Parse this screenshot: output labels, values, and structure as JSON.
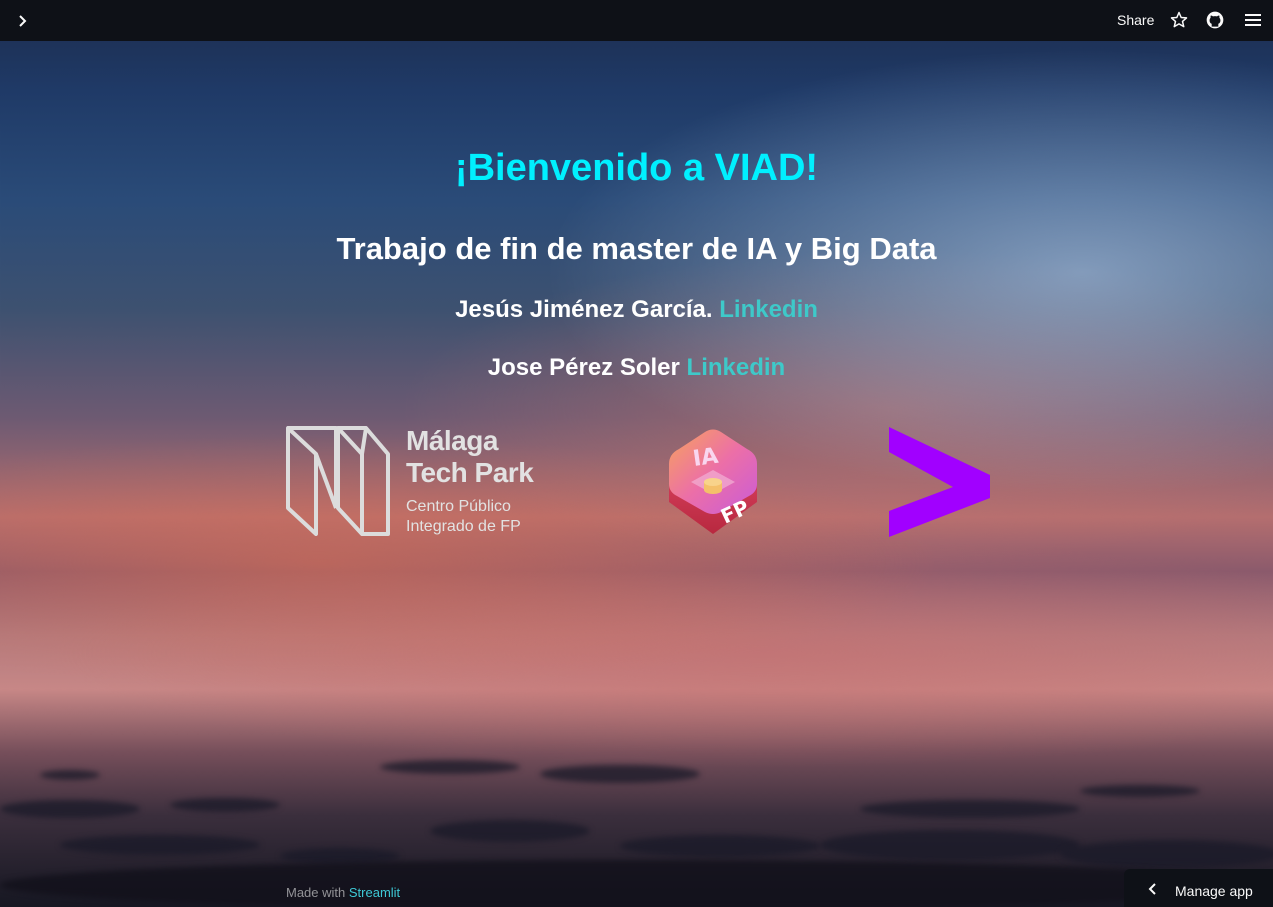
{
  "header": {
    "expand_icon": "chevron-right-icon",
    "share_label": "Share",
    "star_icon": "star-icon",
    "github_icon": "github-icon",
    "menu_icon": "hamburger-menu-icon"
  },
  "main": {
    "title": "¡Bienvenido a VIAD!",
    "subtitle": "Trabajo de fin de master de IA y Big Data",
    "authors": [
      {
        "name": "Jesús Jiménez García.",
        "link_label": "Linkedin"
      },
      {
        "name": "Jose Pérez Soler",
        "link_label": "Linkedin"
      }
    ],
    "logos": {
      "malaga": {
        "line1": "Málaga",
        "line2": "Tech Park",
        "line3": "Centro Público",
        "line4": "Integrado de FP"
      },
      "ia_fp": {
        "badge_top": "IA",
        "badge_bottom": "FP"
      },
      "accenture": {
        "icon": "accenture-chevron-icon",
        "color": "#a100ff"
      }
    }
  },
  "footer": {
    "made_with": "Made with",
    "streamlit": "Streamlit"
  },
  "manage_app": {
    "label": "Manage app",
    "icon": "chevron-left-icon"
  },
  "colors": {
    "title": "#00f0ff",
    "link": "#3ec9c9",
    "topbar": "#0e1117"
  }
}
